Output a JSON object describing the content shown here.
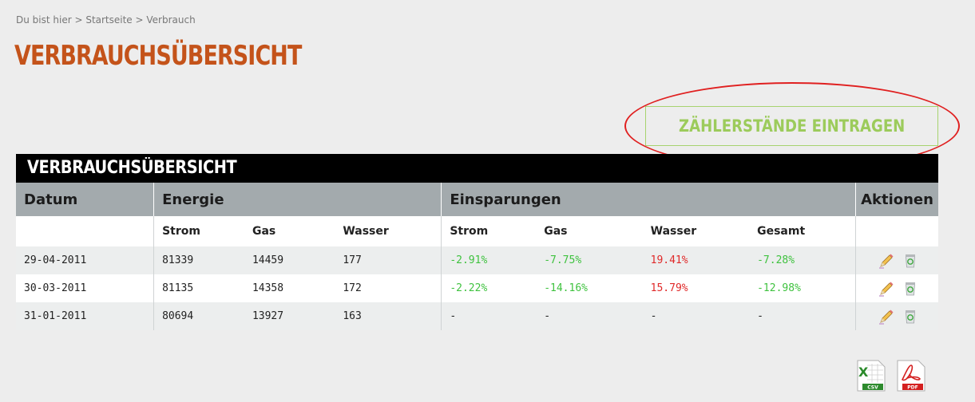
{
  "breadcrumb": "Du bist hier > Startseite > Verbrauch",
  "page_title": "VERBRAUCHSÜBERSICHT",
  "cta_label": "ZÄHLERSTÄNDE EINTRAGEN",
  "table": {
    "caption": "VERBRAUCHSÜBERSICHT",
    "group_headers": {
      "datum": "Datum",
      "energie": "Energie",
      "einsparungen": "Einsparungen",
      "aktionen": "Aktionen"
    },
    "sub_headers": {
      "strom": "Strom",
      "gas": "Gas",
      "wasser": "Wasser",
      "s_strom": "Strom",
      "s_gas": "Gas",
      "s_wasser": "Wasser",
      "s_gesamt": "Gesamt"
    },
    "rows": [
      {
        "datum": "29-04-2011",
        "strom": "81339",
        "gas": "14459",
        "wasser": "177",
        "s_strom": "-2.91%",
        "s_gas": "-7.75%",
        "s_wasser": "19.41%",
        "s_gesamt": "-7.28%"
      },
      {
        "datum": "30-03-2011",
        "strom": "81135",
        "gas": "14358",
        "wasser": "172",
        "s_strom": "-2.22%",
        "s_gas": "-14.16%",
        "s_wasser": "15.79%",
        "s_gesamt": "-12.98%"
      },
      {
        "datum": "31-01-2011",
        "strom": "80694",
        "gas": "13927",
        "wasser": "163",
        "s_strom": "-",
        "s_gas": "-",
        "s_wasser": "-",
        "s_gesamt": "-"
      }
    ]
  },
  "exports": {
    "csv_label": "CSV",
    "pdf_label": "PDF"
  },
  "colors": {
    "title": "#c4531a",
    "cta": "#9ccb5b",
    "positive": "#3fc23f",
    "negative": "#e02a2a",
    "header_bg": "#a3aaad"
  }
}
